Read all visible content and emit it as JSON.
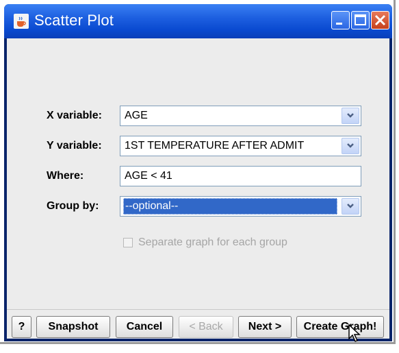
{
  "window": {
    "title": "Scatter Plot",
    "colors": {
      "titlebar": "#1d5fe0",
      "client": "#ececec",
      "selection": "#3168c8"
    }
  },
  "form": {
    "x_variable": {
      "label": "X variable:",
      "value": "AGE"
    },
    "y_variable": {
      "label": "Y variable:",
      "value": "1ST TEMPERATURE AFTER ADMIT"
    },
    "where": {
      "label": "Where:",
      "value": "AGE < 41"
    },
    "group_by": {
      "label": "Group by:",
      "value": "--optional--"
    },
    "separate_graph": {
      "label": "Separate graph for each group",
      "checked": false,
      "enabled": false
    }
  },
  "buttons": {
    "help": "?",
    "snapshot": "Snapshot",
    "cancel": "Cancel",
    "back": "< Back",
    "next": "Next >",
    "create": "Create Graph!"
  },
  "icons": {
    "app": "java-cup-icon",
    "minimize": "minimize-icon",
    "maximize": "maximize-icon",
    "close": "close-icon",
    "dropdown": "chevron-down-icon",
    "cursor": "mouse-pointer-icon"
  }
}
